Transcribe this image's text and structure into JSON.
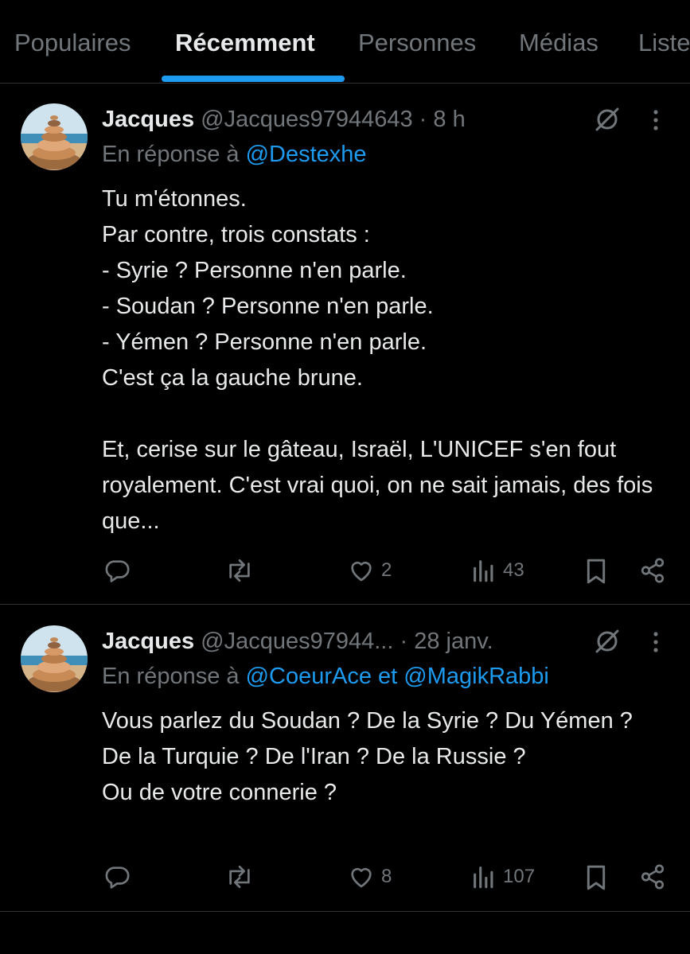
{
  "tabs": [
    {
      "label": "Populaires",
      "active": false
    },
    {
      "label": "Récemment",
      "active": true
    },
    {
      "label": "Personnes",
      "active": false
    },
    {
      "label": "Médias",
      "active": false
    },
    {
      "label": "Listes",
      "active": false
    }
  ],
  "tweets": [
    {
      "author_name": "Jacques",
      "handle": "@Jacques97944643",
      "separator": " · ",
      "time": "8 h",
      "reply_prefix": "En réponse à ",
      "reply_mentions": "@Destexhe",
      "body": "Tu m'étonnes.\nPar contre, trois constats :\n- Syrie ? Personne n'en parle.\n- Soudan ? Personne n'en parle.\n- Yémen ? Personne n'en parle.\nC'est ça la gauche brune.\n\nEt, cerise sur le gâteau, Israël, L'UNICEF s'en fout royalement. C'est vrai quoi, on ne sait jamais, des fois que...",
      "likes": "2",
      "views": "43"
    },
    {
      "author_name": "Jacques",
      "handle": "@Jacques97944...",
      "separator": " · ",
      "time": "28 janv.",
      "reply_prefix": "En réponse à ",
      "reply_mentions": "@CoeurAce et @MagikRabbi",
      "body": "Vous parlez du Soudan ? De la Syrie ? Du Yémen ?  De la Turquie ? De l'Iran ? De la Russie ?\nOu de votre connerie ?",
      "likes": "8",
      "views": "107"
    }
  ],
  "icons": {
    "reply": "reply-icon",
    "repost": "repost-icon",
    "like": "heart-icon",
    "views": "views-icon",
    "bookmark": "bookmark-icon",
    "share": "share-icon",
    "grok": "grok-icon",
    "more": "more-icon"
  },
  "colors": {
    "background": "#000000",
    "text": "#e7e9ea",
    "muted": "#71767b",
    "accent": "#1d9bf0",
    "divider": "#2f3336"
  }
}
